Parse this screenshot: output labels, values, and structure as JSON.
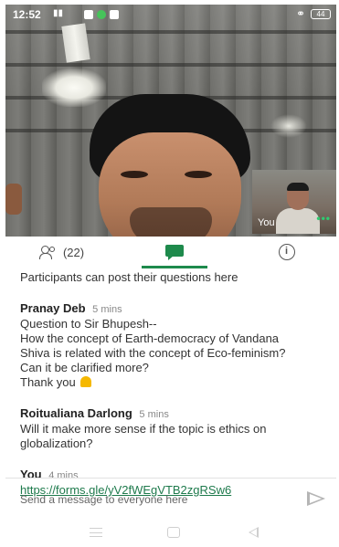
{
  "status_bar": {
    "time": "12:52",
    "signal_text": "⁰ᴮıl ⁵ᴳ",
    "headset_icon": "headset-icon",
    "battery": "44"
  },
  "video": {
    "self_label": "You",
    "more_icon": "more-dots-icon"
  },
  "tabs": {
    "people_count": "(22)",
    "people_icon": "people-icon",
    "chat_icon": "chat-icon",
    "info_icon": "info-icon",
    "active": "chat",
    "accent": "#1e8a4c"
  },
  "chat": {
    "intro": "Participants can post their questions here",
    "messages": [
      {
        "name": "Pranay Deb",
        "time": "5 mins",
        "lines": [
          "Question to Sir Bhupesh--",
          "How the concept of Earth-democracy of Vandana",
          "Shiva is related with the concept of Eco-feminism?",
          "Can it be clarified more?",
          "Thank you"
        ]
      },
      {
        "name": "Roitualiana Darlong",
        "time": "5 mins",
        "lines": [
          "Will it make more sense if the topic is ethics on",
          "globalization?"
        ]
      },
      {
        "name": "You",
        "time": "4 mins",
        "link": "https://forms.gle/yV2fWEgVTB2zgRSw6"
      }
    ]
  },
  "composer": {
    "placeholder": "Send a message to everyone here",
    "send_icon": "send-icon"
  },
  "nav": {
    "menu_icon": "menu-icon",
    "home_icon": "home-icon",
    "back_icon": "back-icon"
  }
}
